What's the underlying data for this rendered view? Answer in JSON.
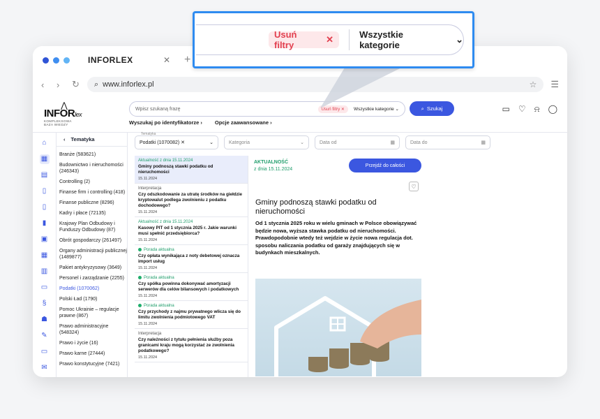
{
  "browser": {
    "tab_title": "INFORLEX",
    "url": "www.inforlex.pl"
  },
  "logo": {
    "word": "INFOR",
    "suffix": "lex",
    "sub1": "KOMPLEKSOWA",
    "sub2": "BAZA WIEDZY"
  },
  "search": {
    "placeholder": "Wpisz szukaną frazę",
    "chip": "Usuń filtry",
    "category": "Wszystkie kategorie",
    "button": "Szukaj",
    "link_identifiers": "Wyszukaj po identyfikatorze",
    "link_advanced": "Opcje zaawansowane"
  },
  "callout": {
    "chip": "Usuń filtry",
    "category": "Wszystkie kategorie"
  },
  "topics": {
    "header": "Tematyka",
    "items": [
      "Branże (583621)",
      "Budownictwo i nieruchomości (246343)",
      "Controlling (2)",
      "Finanse firm i controlling (418)",
      "Finanse publiczne (8296)",
      "Kadry i płace (72135)",
      "Krajowy Plan Odbudowy i Funduszy Odbudowy (87)",
      "Obrót gospodarczy (261497)",
      "Organy administracji publicznej (1489877)",
      "Pakiet antykryzysowy (3649)",
      "Personel i zarządzanie (2255)",
      "Podatki (1070062)",
      "Polski Ład (1790)",
      "Pomoc Ukrainie – regulacje prawne (867)",
      "Prawo administracyjne (548324)",
      "Prawo i życie (16)",
      "Prawo karne (27444)",
      "Prawo konstytucyjne (7421)"
    ]
  },
  "filters": {
    "topic_label": "Tematyka",
    "topic_value": "Podatki (1070082)",
    "category": "Kategoria",
    "date_from": "Data od",
    "date_to": "Data do"
  },
  "results": [
    {
      "tag": "Aktualność z dnia 15.11.2024",
      "title": "Gminy podnoszą stawki podatku od nieruchomości",
      "date": "15.11.2024"
    },
    {
      "tag": "Interpretacja",
      "title": "Czy odszkodowanie za utratę środków na giełdzie kryptowalut podlega zwolnieniu z podatku dochodowego?",
      "date": "15.11.2024"
    },
    {
      "tag": "Aktualność z dnia 15.11.2024",
      "title": "Kasowy PIT od 1 stycznia 2025 r. Jakie warunki musi spełnić przedsiębiorca?",
      "date": "15.11.2024"
    },
    {
      "tag": "Porada aktualna",
      "title": "Czy opłata wynikająca z noty debetowej oznacza import usług",
      "date": "15.11.2024"
    },
    {
      "tag": "Porada aktualna",
      "title": "Czy spółka powinna dokonywać amortyzacji serwerów dla celów bilansowych i podatkowych",
      "date": "15.11.2024"
    },
    {
      "tag": "Porada aktualna",
      "title": "Czy przychody z najmu prywatnego wlicza się do limitu zwolnienia podmiotowego VAT",
      "date": "15.11.2024"
    },
    {
      "tag": "Interpretacja",
      "title": "Czy należności z tytułu pełnienia służby poza granicami kraju mogą korzystać ze zwolnienia podatkowego?",
      "date": "15.11.2024"
    }
  ],
  "article": {
    "tag": "AKTUALNOŚĆ",
    "date": "z dnia 15.11.2024",
    "button": "Przejdź do całości",
    "title": "Gminy podnoszą stawki podatku od nieruchomości",
    "lead": "Od 1 stycznia 2025 roku w wielu gminach w Polsce obowiązywać będzie nowa, wyższa stawka podatku od nieruchomości. Prawdopodobnie wtedy też wejdzie w życie nowa regulacja dot. sposobu naliczania podatku od garaży znajdujących się w budynkach mieszkalnych."
  },
  "colors": {
    "accent": "#3b57e0",
    "chip_red": "#e2404f",
    "green": "#1f9d6b",
    "callout_border": "#2e8bf0"
  }
}
